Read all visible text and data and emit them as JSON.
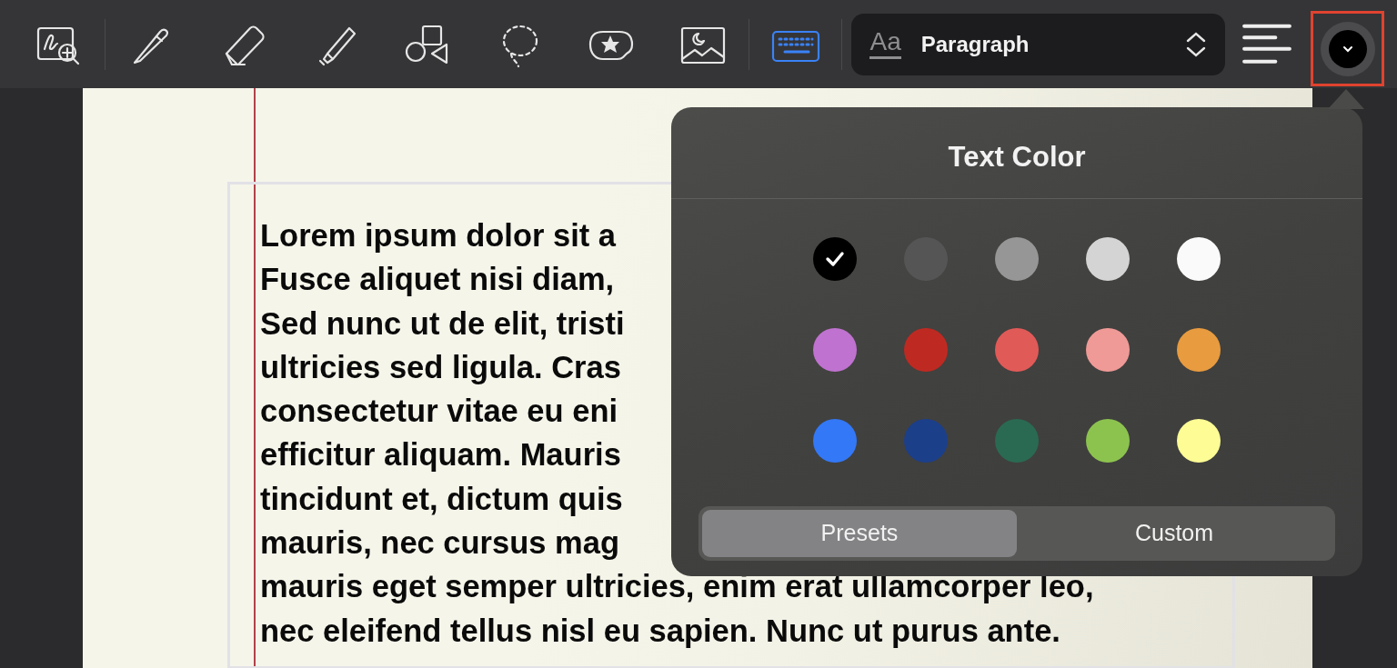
{
  "toolbar": {
    "tools": [
      {
        "kind": "zoom",
        "selected": false
      },
      {
        "kind": "pen",
        "selected": false
      },
      {
        "kind": "eraser",
        "selected": false
      },
      {
        "kind": "highlighter",
        "selected": false
      },
      {
        "kind": "shapes",
        "selected": false
      },
      {
        "kind": "lasso",
        "selected": false
      },
      {
        "kind": "sticker",
        "selected": false
      },
      {
        "kind": "image",
        "selected": false
      },
      {
        "kind": "keyboard",
        "selected": true
      }
    ],
    "style_picker": {
      "icon_text": "Aa",
      "value": "Paragraph"
    },
    "text_color_button": {
      "color": "#000000",
      "highlighted": true
    }
  },
  "note": {
    "lines": [
      "Lorem ipsum dolor sit a",
      "Fusce aliquet nisi diam,",
      "Sed nunc ut de elit, tristi",
      "ultricies sed ligula. Cras",
      "consectetur vitae eu eni",
      "efficitur aliquam. Mauris",
      "tincidunt et, dictum quis",
      "mauris, nec cursus mag",
      "mauris eget semper ultricies, enim erat ullamcorper leo,",
      "nec eleifend tellus nisl eu sapien. Nunc ut purus ante."
    ]
  },
  "popover": {
    "title": "Text Color",
    "swatches": [
      {
        "color": "#000000",
        "selected": true
      },
      {
        "color": "#555555",
        "selected": false
      },
      {
        "color": "#969696",
        "selected": false
      },
      {
        "color": "#d4d4d4",
        "selected": false
      },
      {
        "color": "#fafafa",
        "selected": false
      },
      {
        "color": "#bf72cf",
        "selected": false
      },
      {
        "color": "#be2a22",
        "selected": false
      },
      {
        "color": "#e05a58",
        "selected": false
      },
      {
        "color": "#ef9a97",
        "selected": false
      },
      {
        "color": "#e89b3f",
        "selected": false
      },
      {
        "color": "#3378f6",
        "selected": false
      },
      {
        "color": "#1c3f8a",
        "selected": false
      },
      {
        "color": "#2a6a52",
        "selected": false
      },
      {
        "color": "#8cc34f",
        "selected": false
      },
      {
        "color": "#fdfc95",
        "selected": false
      }
    ],
    "segments": [
      {
        "label": "Presets",
        "selected": true
      },
      {
        "label": "Custom",
        "selected": false
      }
    ]
  }
}
